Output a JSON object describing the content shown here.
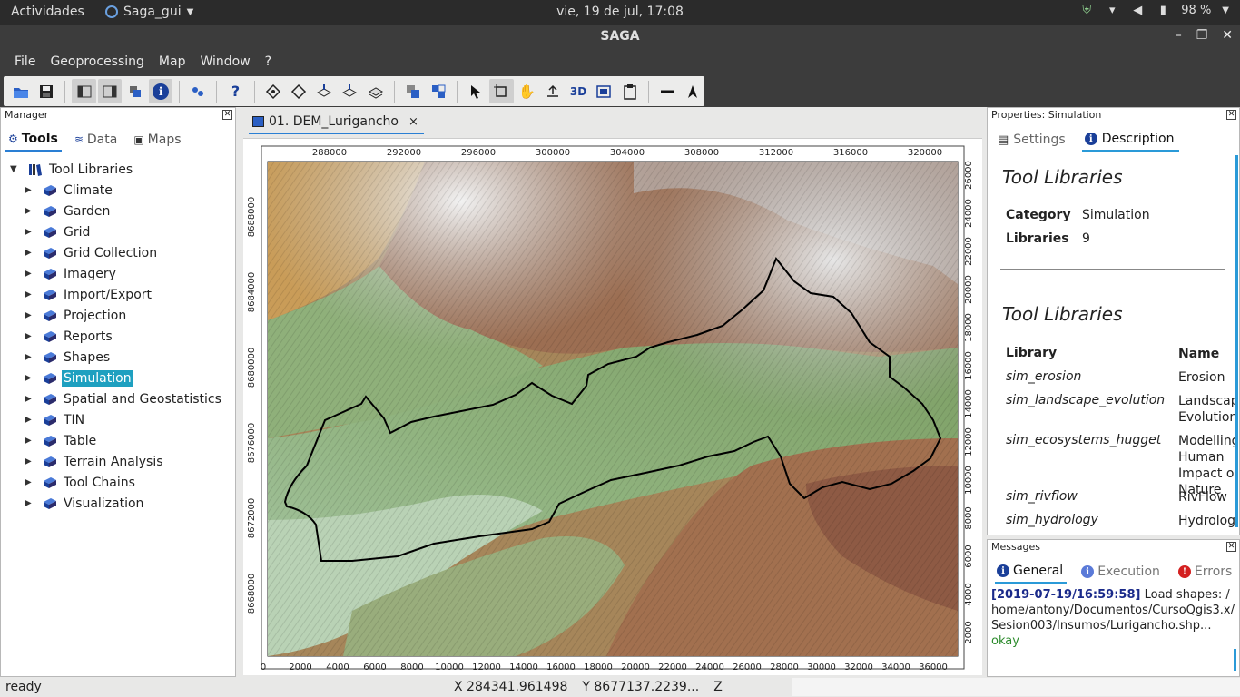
{
  "os": {
    "activities": "Actividades",
    "app_menu": "Saga_gui",
    "clock": "vie, 19 de jul, 17:08",
    "battery": "98 %"
  },
  "window": {
    "title": "SAGA"
  },
  "menu": [
    "File",
    "Geoprocessing",
    "Map",
    "Window",
    "?"
  ],
  "manager": {
    "title": "Manager",
    "tabs": {
      "tools": "Tools",
      "data": "Data",
      "maps": "Maps"
    },
    "root": "Tool Libraries",
    "items": [
      "Climate",
      "Garden",
      "Grid",
      "Grid Collection",
      "Imagery",
      "Import/Export",
      "Projection",
      "Reports",
      "Shapes",
      "Simulation",
      "Spatial and Geostatistics",
      "TIN",
      "Table",
      "Terrain Analysis",
      "Tool Chains",
      "Visualization"
    ],
    "selected": "Simulation"
  },
  "map": {
    "tab_label": "01. DEM_Lurigancho",
    "x_ticks_top": [
      "288000",
      "292000",
      "296000",
      "300000",
      "304000",
      "308000",
      "312000",
      "316000",
      "320000"
    ],
    "y_ticks_left": [
      "8688000",
      "8684000",
      "8680000",
      "8676000",
      "8672000",
      "8668000"
    ],
    "x_ticks_bottom": [
      "0",
      "2000",
      "4000",
      "6000",
      "8000",
      "10000",
      "12000",
      "14000",
      "16000",
      "18000",
      "20000",
      "22000",
      "24000",
      "26000",
      "28000",
      "30000",
      "32000",
      "34000",
      "36000"
    ],
    "y_ticks_right": [
      "26000",
      "24000",
      "22000",
      "20000",
      "18000",
      "16000",
      "14000",
      "12000",
      "10000",
      "8000",
      "6000",
      "4000",
      "2000"
    ]
  },
  "properties": {
    "title": "Properties: Simulation",
    "tabs": {
      "settings": "Settings",
      "description": "Description"
    },
    "heading1": "Tool Libraries",
    "category_label": "Category",
    "category_value": "Simulation",
    "libraries_label": "Libraries",
    "libraries_value": "9",
    "heading2": "Tool Libraries",
    "col_library": "Library",
    "col_name": "Name",
    "rows": [
      {
        "library": "sim_erosion",
        "name": "Erosion"
      },
      {
        "library": "sim_landscape_evolution",
        "name": "Landscape Evolution"
      },
      {
        "library": "sim_ecosystems_hugget",
        "name": "Modelling Human Impact on Nature"
      },
      {
        "library": "sim_rivflow",
        "name": "RivFlow"
      },
      {
        "library": "sim_hydrology",
        "name": "Hydrology"
      }
    ]
  },
  "messages": {
    "title": "Messages",
    "tabs": {
      "general": "General",
      "execution": "Execution",
      "errors": "Errors"
    },
    "timestamp": "[2019-07-19/16:59:58]",
    "text": " Load shapes: /home/antony/Documentos/CursoQgis3.x/Sesion003/Insumos/Lurigancho.shp...",
    "result": "okay"
  },
  "status": {
    "state": "ready",
    "x": "X 284341.961498",
    "y": "Y 8677137.2239...",
    "z": "Z"
  }
}
